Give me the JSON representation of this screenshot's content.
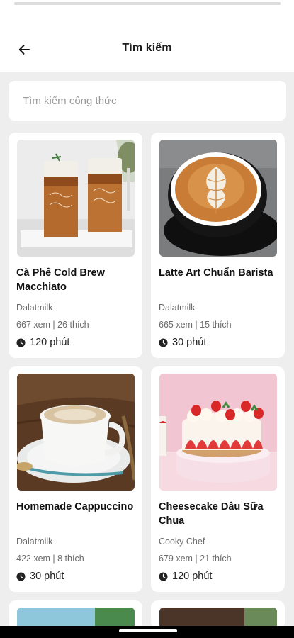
{
  "header": {
    "title": "Tìm kiếm"
  },
  "search": {
    "placeholder": "Tìm kiếm công thức",
    "value": ""
  },
  "recipes": [
    {
      "name": "Cà Phê Cold Brew Macchiato",
      "author": "Dalatmilk",
      "stats": "667 xem | 26 thích",
      "time": "120 phút"
    },
    {
      "name": "Latte Art Chuẩn Barista",
      "author": "Dalatmilk",
      "stats": "665 xem | 15 thích",
      "time": "30 phút"
    },
    {
      "name": "Homemade Cappuccino",
      "author": "Dalatmilk",
      "stats": "422 xem | 8 thích",
      "time": "30 phút"
    },
    {
      "name": "Cheesecake Dâu Sữa Chua",
      "author": "Cooky Chef",
      "stats": "679 xem | 21 thích",
      "time": "120 phút"
    }
  ],
  "icons": {
    "back": "arrow-left-icon",
    "time": "clock-icon"
  },
  "colors": {
    "background": "#eeeeee",
    "card": "#ffffff",
    "text": "#1b1b1b",
    "muted": "#6a6a6a"
  }
}
